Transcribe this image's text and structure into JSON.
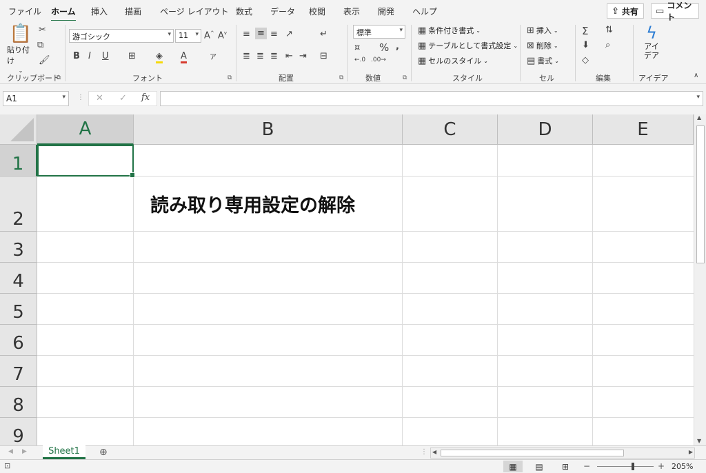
{
  "tabs": [
    "ファイル",
    "ホーム",
    "挿入",
    "描画",
    "ページ レイアウト",
    "数式",
    "データ",
    "校閲",
    "表示",
    "開発",
    "ヘルプ"
  ],
  "active_tab": "ホーム",
  "share_label": "共有",
  "comment_label": "コメント",
  "ribbon": {
    "clipboard": {
      "label": "クリップボード",
      "paste": "貼り付け"
    },
    "font": {
      "label": "フォント",
      "font_name": "游ゴシック",
      "font_size": "11",
      "bold": "B",
      "italic": "I",
      "underline": "U"
    },
    "alignment": {
      "label": "配置"
    },
    "number": {
      "label": "数値",
      "format": "標準"
    },
    "styles": {
      "label": "スタイル",
      "conditional": "条件付き書式",
      "table": "テーブルとして書式設定",
      "cell_styles": "セルのスタイル"
    },
    "cells": {
      "label": "セル",
      "insert": "挿入",
      "delete": "削除",
      "format": "書式"
    },
    "editing": {
      "label": "編集"
    },
    "ideas": {
      "label": "アイデア",
      "button": "アイ\nデア"
    }
  },
  "formula_bar": {
    "name_box": "A1",
    "fx": "fx",
    "formula": ""
  },
  "columns": [
    "A",
    "B",
    "C",
    "D",
    "E"
  ],
  "rows": [
    "1",
    "2",
    "3",
    "4",
    "5",
    "6",
    "7",
    "8",
    "9"
  ],
  "cells": {
    "B2": "読み取り専用設定の解除"
  },
  "sheets": [
    "Sheet1"
  ],
  "status": {
    "zoom": "205%"
  },
  "accent_color": "#217346"
}
